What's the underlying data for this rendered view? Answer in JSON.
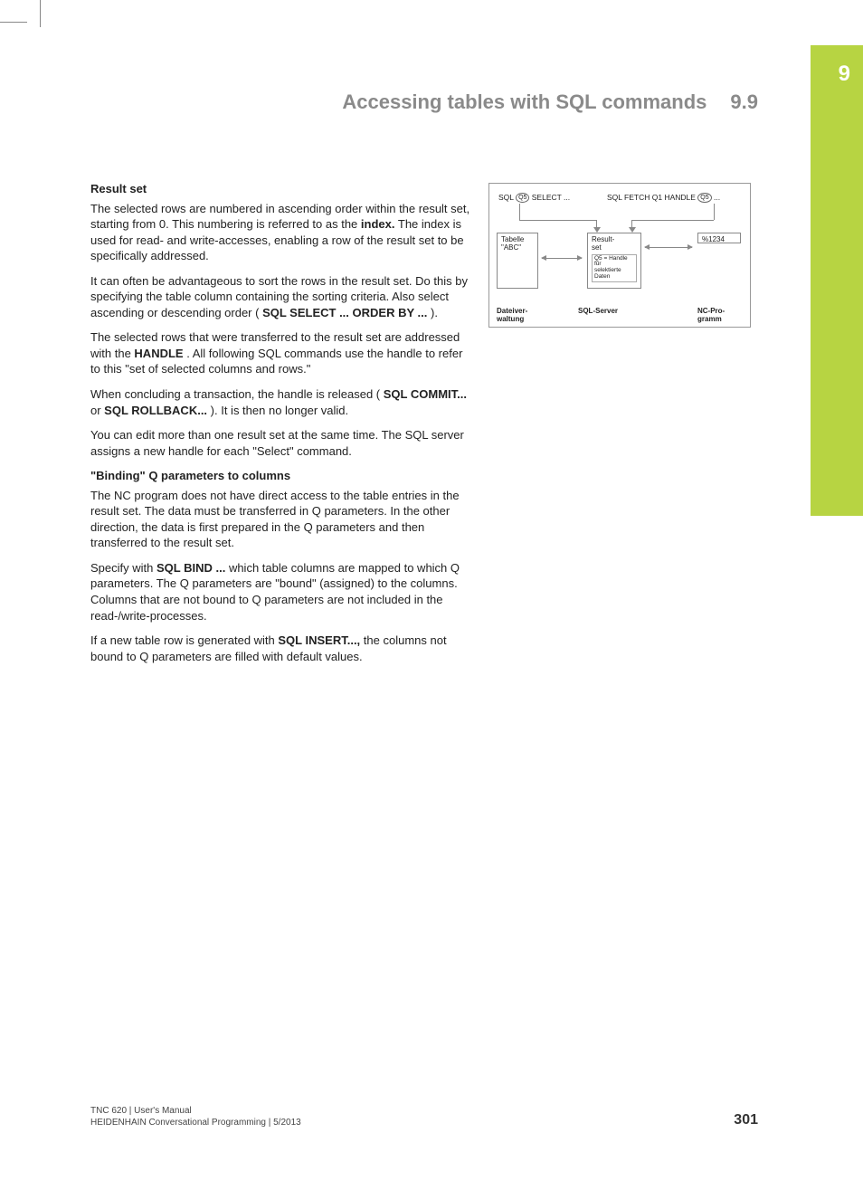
{
  "sideTab": {
    "chapter": "9"
  },
  "header": {
    "title": "Accessing tables with SQL commands",
    "section": "9.9"
  },
  "body": {
    "h1": "Result set",
    "p1": {
      "a": "The selected rows are numbered in ascending order within the result set, starting from 0. This numbering is referred to as the ",
      "b": "index.",
      "c": " The index is used for read- and write-accesses, enabling a row of the result set to be specifically addressed."
    },
    "p2": {
      "a": "It can often be advantageous to sort the rows in the result set. Do this by specifying the table column containing the sorting criteria. Also select ascending or descending order (",
      "b": "SQL SELECT ... ORDER BY ...",
      "c": ")."
    },
    "p3": {
      "a": "The selected rows that were transferred to the result set are addressed with the ",
      "b": "HANDLE",
      "c": ". All following SQL commands use the handle to refer to this \"set of selected columns and rows.\""
    },
    "p4": {
      "a": "When concluding a transaction, the handle is released (",
      "b": "SQL COMMIT...",
      "c": " or ",
      "d": "SQL ROLLBACK...",
      "e": "). It is then no longer valid."
    },
    "p5": "You can edit more than one result set at the same time. The SQL server assigns a new handle for each \"Select\" command.",
    "h2": "\"Binding\" Q parameters to columns",
    "p6": "The NC program does not have direct access to the table entries in the result set. The data must be transferred in Q parameters. In the other direction, the data is first prepared in the Q parameters and then transferred to the result set.",
    "p7": {
      "a": "Specify with ",
      "b": "SQL BIND ...",
      "c": " which table columns are mapped to which Q parameters. The Q parameters are \"bound\" (assigned) to the columns. Columns that are not bound to Q parameters are not included in the read-/write-processes."
    },
    "p8": {
      "a": "If a new table row is generated with ",
      "b": "SQL INSERT...,",
      "c": " the columns not bound to Q parameters are filled with default values."
    }
  },
  "diagram": {
    "topLeft": {
      "pre": "SQL ",
      "circ": "Q5",
      "post": " SELECT ..."
    },
    "topRight": {
      "pre": "SQL FETCH Q1 HANDLE ",
      "circ": "Q5",
      "post": " ..."
    },
    "boxTable": "Tabelle\n\"ABC\"",
    "boxResult": "Result-\nset",
    "boxResultSub": "Q5 = Handle\nfür\nselektierte\nDaten",
    "boxProg": "%1234",
    "lbl1": "Dateiver-\nwaltung",
    "lbl2": "SQL-Server",
    "lbl3": "NC-Pro-\ngramm"
  },
  "footer": {
    "line1": "TNC 620 | User's Manual",
    "line2": "HEIDENHAIN Conversational Programming | 5/2013",
    "page": "301"
  }
}
